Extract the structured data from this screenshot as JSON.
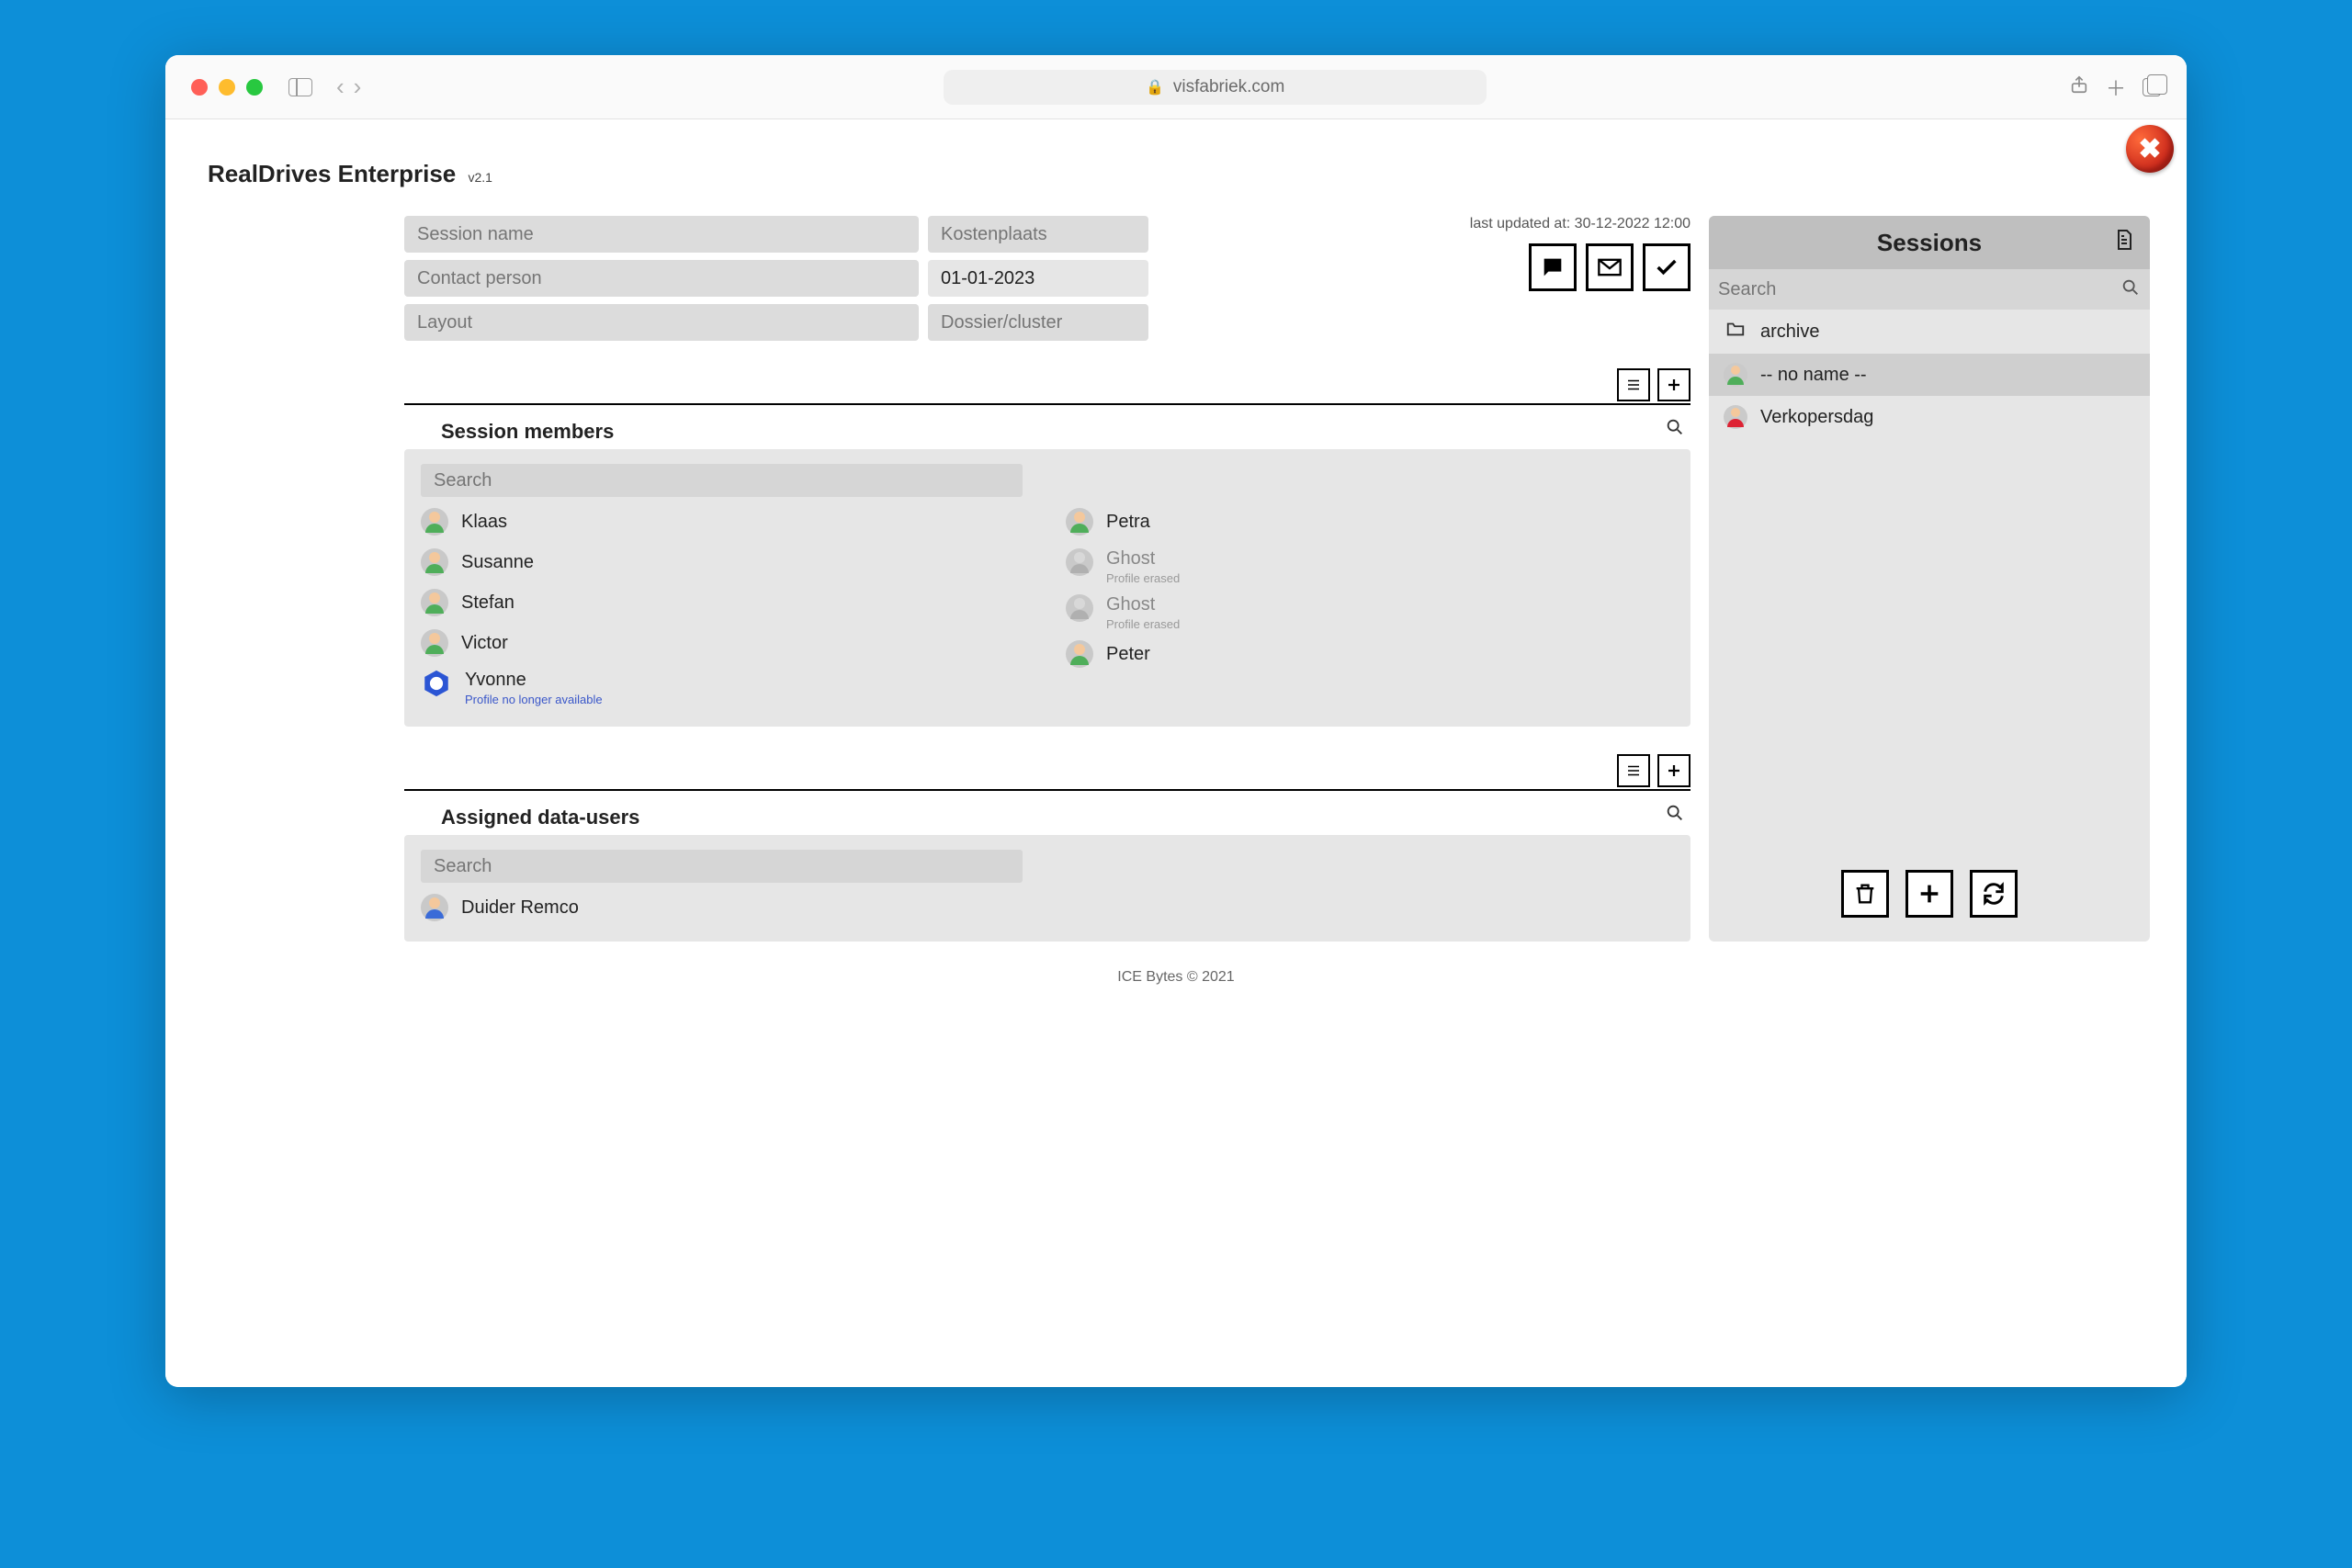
{
  "browser": {
    "url": "visfabriek.com"
  },
  "app": {
    "title": "RealDrives Enterprise",
    "version": "v2.1",
    "last_updated_label": "last updated at:",
    "last_updated_value": "30-12-2022 12:00"
  },
  "form": {
    "session_name_ph": "Session name",
    "contact_person_ph": "Contact person",
    "layout_ph": "Layout",
    "kostenplaats_ph": "Kostenplaats",
    "date_value": "01-01-2023",
    "dossier_ph": "Dossier/cluster"
  },
  "members": {
    "title": "Session members",
    "search_ph": "Search",
    "list_left": [
      {
        "name": "Klaas",
        "avatar": "green"
      },
      {
        "name": "Susanne",
        "avatar": "green"
      },
      {
        "name": "Stefan",
        "avatar": "green"
      },
      {
        "name": "Victor",
        "avatar": "green"
      },
      {
        "name": "Yvonne",
        "avatar": "hex",
        "sub": "Profile no longer available"
      }
    ],
    "list_right": [
      {
        "name": "Petra",
        "avatar": "green"
      },
      {
        "name": "Ghost",
        "avatar": "grey",
        "sub": "Profile erased",
        "ghost": true
      },
      {
        "name": "Ghost",
        "avatar": "grey",
        "sub": "Profile erased",
        "ghost": true
      },
      {
        "name": "Peter",
        "avatar": "green"
      }
    ]
  },
  "datausers": {
    "title": "Assigned data-users",
    "search_ph": "Search",
    "list": [
      {
        "name": "Duider Remco",
        "avatar": "blue"
      }
    ]
  },
  "sessions": {
    "title": "Sessions",
    "search_ph": "Search",
    "items": [
      {
        "label": "archive",
        "icon": "folder"
      },
      {
        "label": "-- no name --",
        "icon": "person-grey",
        "selected": true
      },
      {
        "label": "Verkopersdag",
        "icon": "person-red"
      }
    ]
  },
  "footer": "ICE Bytes © 2021"
}
